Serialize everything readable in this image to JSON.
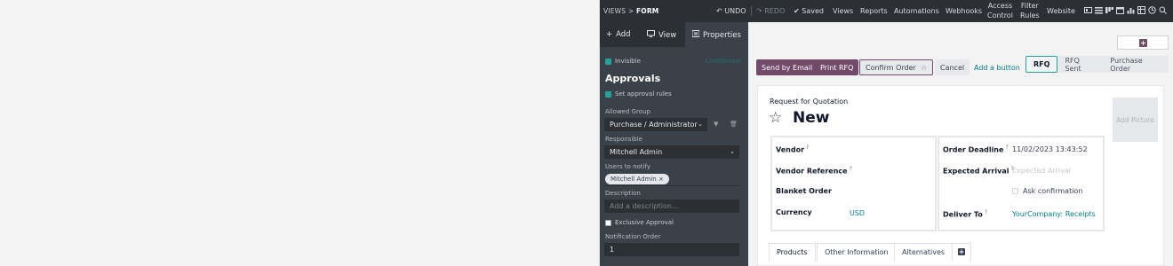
{
  "breadcrumb": {
    "parent": "VIEWS",
    "sep": ">",
    "current": "FORM"
  },
  "topbar": {
    "undo": "UNDO",
    "redo": "REDO",
    "saved": "Saved",
    "menu": [
      "Views",
      "Reports",
      "Automations",
      "Webhooks"
    ],
    "access_control": [
      "Access",
      "Control"
    ],
    "filter_rules": [
      "Filter",
      "Rules"
    ],
    "website": "Website",
    "view_icons": [
      "form-view-icon",
      "list-view-icon",
      "kanban-view-icon",
      "calendar-view-icon",
      "graph-view-icon",
      "pivot-view-icon",
      "activity-view-icon",
      "search-view-icon"
    ]
  },
  "sidebar": {
    "tabs": {
      "add": "Add",
      "view": "View",
      "properties": "Properties"
    },
    "invisible_label": "Invisible",
    "conditional": "Conditional",
    "section_title": "Approvals",
    "set_approval_rules": "Set approval rules",
    "allowed_group_label": "Allowed Group",
    "allowed_group_value": "Purchase / Administrator",
    "responsible_label": "Responsible",
    "responsible_value": "Mitchell Admin",
    "users_notify_label": "Users to notify",
    "users_notify_tag": "Mitchell Admin",
    "description_label": "Description",
    "description_placeholder": "Add a description...",
    "exclusive_approval": "Exclusive Approval",
    "notification_order_label": "Notification Order",
    "notification_order_value": "1"
  },
  "actions": {
    "send_email": "Send by Email",
    "print_rfq": "Print RFQ",
    "confirm_order": "Confirm Order",
    "cancel": "Cancel",
    "add_button": "Add a button"
  },
  "statusbar": [
    "RFQ",
    "RFQ Sent",
    "Purchase Order"
  ],
  "document": {
    "subtitle": "Request for Quotation",
    "title": "New",
    "add_picture": "Add Picture"
  },
  "fields_left": [
    {
      "label": "Vendor",
      "help": "?",
      "value": ""
    },
    {
      "label": "Vendor Reference",
      "help": "?",
      "value": ""
    },
    {
      "label": "Blanket Order",
      "help": "",
      "value": ""
    },
    {
      "label": "Currency",
      "help": "",
      "value": "USD"
    }
  ],
  "fields_right": {
    "order_deadline_label": "Order Deadline",
    "order_deadline_value": "11/02/2023 13:43:52",
    "expected_arrival_label": "Expected Arrival",
    "expected_arrival_placeholder": "Expected Arrival",
    "ask_confirmation": "Ask confirmation",
    "deliver_to_label": "Deliver To",
    "deliver_to_value": "YourCompany: Receipts"
  },
  "notebook_tabs": [
    "Products",
    "Other Information",
    "Alternatives"
  ],
  "colors": {
    "brand": "#714b67",
    "accent": "#017e84",
    "dark": "#2c3035"
  }
}
